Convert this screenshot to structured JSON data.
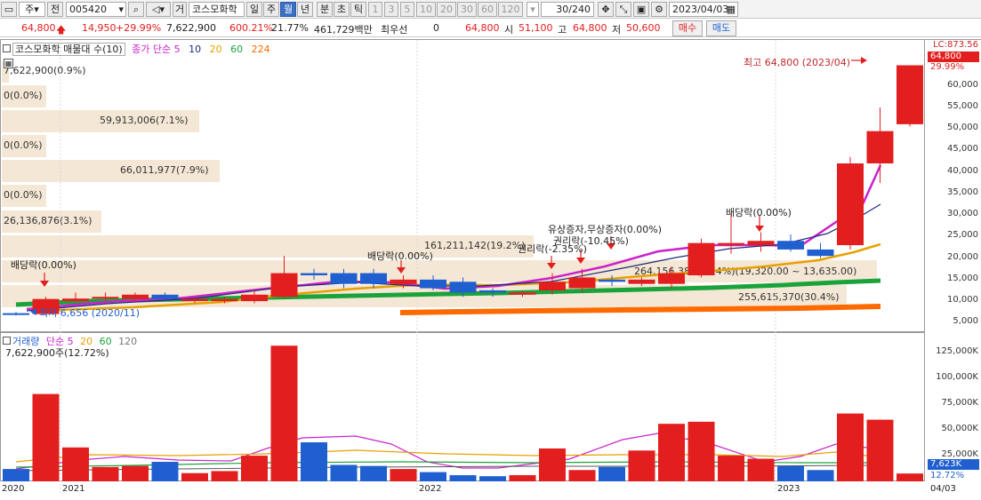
{
  "toolbar": {
    "market": "주",
    "prev": "전",
    "code": "005420",
    "geo": "거",
    "name": "코스모화학",
    "periods": [
      "일",
      "주",
      "월",
      "년"
    ],
    "period_selected": "월",
    "ticks": [
      "분",
      "초",
      "틱"
    ],
    "nums": [
      "1",
      "3",
      "5",
      "10",
      "20",
      "30",
      "60",
      "120"
    ],
    "count": "30/240",
    "date": "2023/04/03"
  },
  "quote": {
    "price": "64,800",
    "change": "14,950",
    "change_pct": "+29.99%",
    "volume": "7,622,900",
    "vol_ratio": "600.21%",
    "turnover": "21.77%",
    "amount": "461,729백만",
    "best_label": "최우선",
    "best_val": "0",
    "last": "64,800",
    "open_label": "시",
    "open": "51,100",
    "high_label": "고",
    "high": "64,800",
    "low_label": "저",
    "low": "50,600",
    "buy": "매수",
    "sell": "매도"
  },
  "legend_price": {
    "title": "코스모화학 매물대 수(10)",
    "ma_label": "종가 단순",
    "ma": [
      "5",
      "10",
      "20",
      "60",
      "224"
    ]
  },
  "legend_volume": {
    "title": "거래량",
    "ma_label": "단순",
    "ma": [
      "5",
      "20",
      "60",
      "120"
    ],
    "value": "7,622,900주(12.72%)"
  },
  "price_axis": {
    "top": "LC:873.56",
    "current": "64,800",
    "current_pct": "29.99%",
    "ticks": [
      "60,000",
      "55,000",
      "50,000",
      "45,000",
      "40,000",
      "35,000",
      "30,000",
      "25,000",
      "20,000",
      "15,000",
      "10,000",
      "5,000"
    ]
  },
  "volume_axis": {
    "ticks": [
      "125,000K",
      "100,000K",
      "75,000K",
      "50,000K",
      "25,000K"
    ],
    "current": "7,623K",
    "current_pct": "12.72%"
  },
  "bands": [
    "7,622,900(0.9%)",
    "0(0.0%)",
    "59,913,006(7.1%)",
    "0(0.0%)",
    "66,011,977(7.9%)",
    "0(0.0%)",
    "26,136,876(3.1%)",
    "161,211,142(19.2%)",
    "264,156,388(31.4%)(19,320.00 ~ 13,635.00)",
    "255,615,370(30.4%)"
  ],
  "annotations": {
    "high": "최고 64,800 (2023/04)",
    "low": "최저 6,656 (2020/11)",
    "div1": "배당락(0.00%)",
    "div2": "배당락(0.00%)",
    "div3": "배당락(0.00%)",
    "rights1": "유상증자,무상증자(0.00%)",
    "rights2": "권리락(-10.45%)",
    "rights3": "권리락(-2.35%)"
  },
  "dates": [
    "2020",
    "2021",
    "2022",
    "2023",
    "04/03"
  ],
  "chart_data": {
    "type": "candlestick",
    "x": [
      "2020/10",
      "2020/11",
      "2020/12",
      "2021/01",
      "2021/02",
      "2021/03",
      "2021/04",
      "2021/05",
      "2021/06",
      "2021/07",
      "2021/08",
      "2021/09",
      "2021/10",
      "2021/11",
      "2021/12",
      "2022/01",
      "2022/02",
      "2022/03",
      "2022/04",
      "2022/05",
      "2022/06",
      "2022/07",
      "2022/08",
      "2022/09",
      "2022/10",
      "2022/11",
      "2022/12",
      "2023/01",
      "2023/02",
      "2023/03",
      "2023/04"
    ],
    "open": [
      7200,
      7000,
      10000,
      11000,
      10500,
      11500,
      10000,
      10000,
      10000,
      11000,
      16500,
      16500,
      16500,
      14000,
      15000,
      14500,
      12500,
      11500,
      12500,
      13000,
      15000,
      14000,
      14000,
      16000,
      23000,
      23000,
      24000,
      22000,
      23000,
      42000,
      51100
    ],
    "close": [
      6900,
      10500,
      10600,
      11000,
      11500,
      10500,
      10500,
      10500,
      11500,
      16500,
      16000,
      14000,
      14000,
      15000,
      13000,
      12000,
      12000,
      12000,
      14500,
      15500,
      14500,
      15000,
      16500,
      23500,
      23500,
      24000,
      22000,
      20500,
      42000,
      49500,
      64800
    ],
    "high": [
      7500,
      11000,
      12000,
      12000,
      12000,
      12000,
      11000,
      11000,
      12500,
      20500,
      17500,
      17500,
      17500,
      16000,
      16000,
      15500,
      13000,
      12500,
      16500,
      17500,
      16000,
      15500,
      18000,
      24500,
      30500,
      26000,
      25500,
      23500,
      43500,
      55000,
      64800
    ],
    "low": [
      6656,
      6800,
      9800,
      10000,
      9800,
      10000,
      9500,
      9500,
      9500,
      10500,
      15000,
      13000,
      13000,
      13000,
      12500,
      11000,
      11000,
      11000,
      11500,
      12000,
      13500,
      13500,
      13000,
      15500,
      21000,
      21500,
      21500,
      20000,
      22000,
      37500,
      50600
    ],
    "volume_k": [
      12000,
      85000,
      33000,
      14000,
      15000,
      19000,
      8000,
      10000,
      25000,
      132000,
      38000,
      16000,
      15000,
      12000,
      9000,
      6000,
      5000,
      6000,
      32000,
      11000,
      14000,
      30000,
      56000,
      58000,
      25000,
      22000,
      15000,
      11000,
      66000,
      60000,
      7623
    ],
    "ylim": [
      3000,
      68000
    ],
    "volume_ylim": [
      0,
      140000
    ]
  }
}
